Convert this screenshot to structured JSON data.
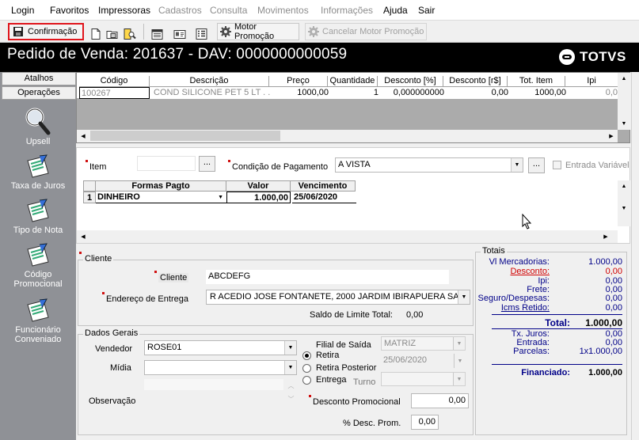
{
  "menu": {
    "items": [
      {
        "label": "Login",
        "disabled": false
      },
      {
        "label": "Favoritos",
        "disabled": false
      },
      {
        "label": "Impressoras",
        "disabled": false
      },
      {
        "label": "Cadastros",
        "disabled": true
      },
      {
        "label": "Consulta",
        "disabled": true
      },
      {
        "label": "Movimentos",
        "disabled": true
      },
      {
        "label": "Informações",
        "disabled": true
      },
      {
        "label": "Ajuda",
        "disabled": false
      },
      {
        "label": "Sair",
        "disabled": false
      }
    ]
  },
  "toolbar": {
    "confirm_label": "Confirmação",
    "motor_label": "Motor Promoção",
    "cancel_motor_label": "Cancelar Motor Promoção",
    "highlight_color": "#e0151c"
  },
  "header": {
    "title": "Pedido de Venda: 201637  - DAV: 0000000000059",
    "logo_text": "TOTVS"
  },
  "sidebar": {
    "tabs": [
      "Atalhos",
      "Operações"
    ],
    "items": [
      {
        "label": "Upsell",
        "icon": "magnifier-icon"
      },
      {
        "label": "Taxa de Juros",
        "icon": "checklist-icon"
      },
      {
        "label": "Tipo de Nota",
        "icon": "checklist-icon"
      },
      {
        "label": "Código Promocional",
        "icon": "checklist-icon"
      },
      {
        "label": "Funcionário Conveniado",
        "icon": "checklist-icon"
      }
    ]
  },
  "items_grid": {
    "columns": [
      "Código",
      "Descrição",
      "Preço",
      "Quantidade",
      "Desconto [%]",
      "Desconto [r$]",
      "Tot. Item",
      "Ipi"
    ],
    "rows": [
      [
        "100267",
        "COND SILICONE PET 5 LT  . .",
        "1000,00",
        "1",
        "0,000000000",
        "0,00",
        "1000,00",
        "0,0"
      ]
    ]
  },
  "payment": {
    "item_label": "Item",
    "item_value": "",
    "item_button": "...",
    "condition_label": "Condição de Pagamento",
    "condition_value": "A VISTA",
    "condition_button": "...",
    "variable_entry_label": "Entrada Variável",
    "grid_columns": [
      "Formas Pagto",
      "Valor",
      "Vencimento"
    ],
    "grid_rows": [
      {
        "index": "1",
        "form": "DINHEIRO",
        "value": "1.000,00",
        "due": "25/06/2020"
      }
    ]
  },
  "client": {
    "group_label": "Cliente",
    "client_label": "Cliente",
    "client_value": "ABCDEFG",
    "address_label": "Endereço de Entrega",
    "address_value": "R  ACEDIO JOSE FONTANETE, 2000  JARDIM IBIRAPUERA SA",
    "limit_label": "Saldo de Limite Total:",
    "limit_value": "0,00"
  },
  "general": {
    "group_label": "Dados Gerais",
    "seller_label": "Vendedor",
    "seller_value": "ROSE01",
    "media_label": "Mídia",
    "media_value": "",
    "observation_label": "Observação",
    "branch_label": "Filial de Saída",
    "branch_value": "MATRIZ",
    "delivery_options": [
      "Retira",
      "Retira Posterior",
      "Entrega"
    ],
    "delivery_selected": "Retira",
    "date_value": "25/06/2020",
    "shift_label": "Turno",
    "shift_value": "",
    "promo_discount_label": "Desconto Promocional",
    "promo_discount_value": "0,00",
    "promo_percent_label": "% Desc. Prom.",
    "promo_percent_value": "0,00"
  },
  "totals": {
    "group_label": "Totais",
    "rows": [
      {
        "label": "Vl Mercadorias:",
        "value": "1.000,00"
      },
      {
        "label": "Desconto:",
        "value": "0,00"
      },
      {
        "label": "Ipi:",
        "value": "0,00"
      },
      {
        "label": "Frete:",
        "value": "0,00"
      },
      {
        "label": "Seguro/Despesas:",
        "value": "0,00"
      },
      {
        "label": "Icms Retido:",
        "value": "0,00"
      }
    ],
    "total_label": "Total:",
    "total_value": "1.000,00",
    "rows2": [
      {
        "label": "Tx. Juros:",
        "value": "0,00"
      },
      {
        "label": "Entrada:",
        "value": "0,00"
      },
      {
        "label": "Parcelas:",
        "value": "1x1.000,00"
      }
    ],
    "financed_label": "Financiado:",
    "financed_value": "1.000,00"
  }
}
